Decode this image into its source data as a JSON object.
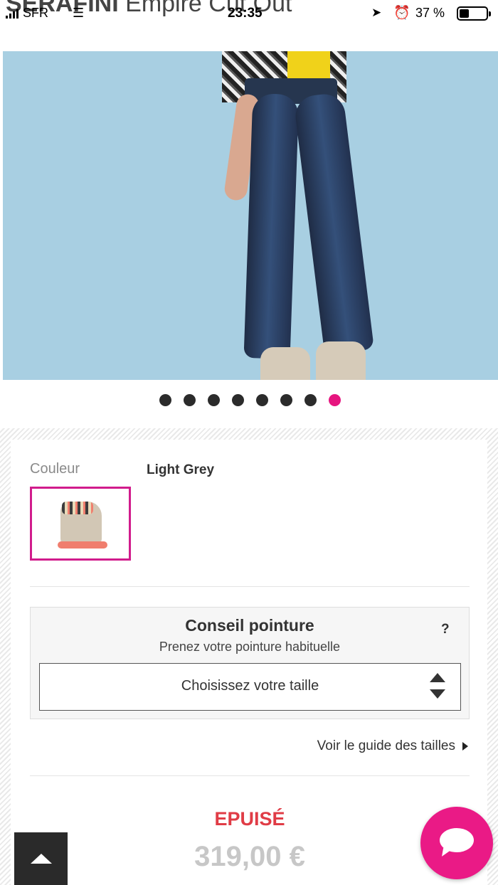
{
  "status_bar": {
    "carrier": "SFR",
    "time": "23:35",
    "battery": "37 %",
    "battery_level": 0.37,
    "icons": [
      "signal-icon",
      "wifi-icon",
      "location-arrow-icon",
      "alarm-icon",
      "battery-icon"
    ]
  },
  "header": {
    "brand": "SERAFINI",
    "product_name": "Empire Cut Out"
  },
  "carousel": {
    "total_images": 8,
    "active_index": 7
  },
  "product": {
    "color_label": "Couleur",
    "color_value": "Light Grey"
  },
  "size": {
    "title": "Conseil pointure",
    "help": "?",
    "subtitle": "Prenez votre pointure habituelle",
    "select_placeholder": "Choisissez votre taille",
    "guide_link": "Voir le guide des tailles"
  },
  "purchase": {
    "status": "EPUISÉ",
    "price": "319,00 €"
  },
  "colors": {
    "accent": "#e6157f",
    "soldout": "#e03c46",
    "price_disabled": "#c7c7c7"
  }
}
